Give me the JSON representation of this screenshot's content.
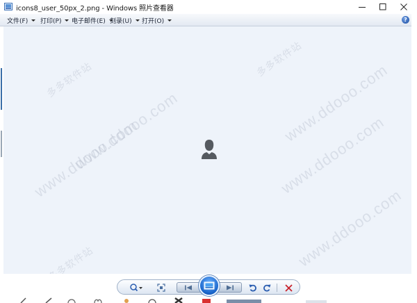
{
  "window": {
    "title": "icons8_user_50px_2.png - Windows 照片查看器"
  },
  "menu": {
    "items": [
      {
        "label": "文件(F)"
      },
      {
        "label": "打印(P)"
      },
      {
        "label": "电子邮件(E)"
      },
      {
        "label": "刻录(U)"
      },
      {
        "label": "打开(O)"
      }
    ],
    "help_label": "?"
  },
  "watermark": {
    "text": "www.ddooo.com",
    "brand": "多多软件站"
  },
  "colors": {
    "viewer_bg": "#eef3fa",
    "slideshow_blue": "#1763c9",
    "delete_red": "#c8232c",
    "rotate_blue": "#2a5db0"
  },
  "controls": {
    "zoom": "zoom-icon",
    "actual_size": "actual-size-icon",
    "previous": "previous-icon",
    "slideshow": "slideshow-icon",
    "next": "next-icon",
    "rotate_ccw": "rotate-counterclockwise-icon",
    "rotate_cw": "rotate-clockwise-icon",
    "delete": "delete-icon"
  }
}
